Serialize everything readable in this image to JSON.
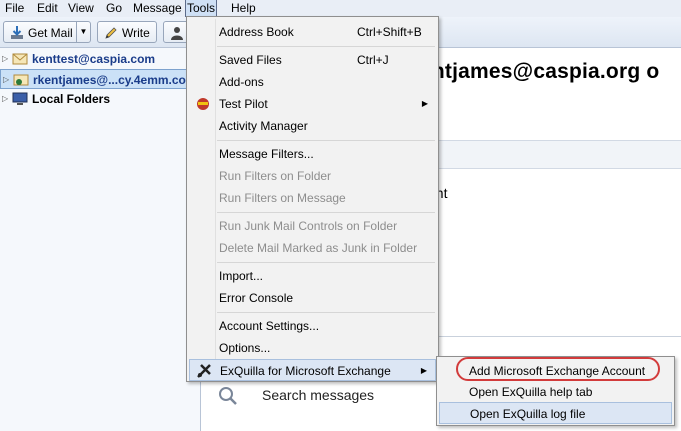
{
  "menubar": {
    "items": [
      "File",
      "Edit",
      "View",
      "Go",
      "Message",
      "Tools",
      "Help"
    ],
    "active": "Tools"
  },
  "toolbar": {
    "get_mail": "Get Mail",
    "write": "Write"
  },
  "folders": [
    {
      "label": "kenttest@caspia.com",
      "selected": false,
      "icon": "inbox-envelope-icon"
    },
    {
      "label": "rkentjames@...cy.4emm.co",
      "selected": true,
      "icon": "exchange-account-icon"
    },
    {
      "label": "Local Folders",
      "selected": false,
      "icon": "computer-icon"
    }
  ],
  "content": {
    "heading": "entjames@caspia.org o",
    "partial_text": "unt",
    "search_placeholder": "Search messages"
  },
  "tools_menu": {
    "items": [
      {
        "label": "Address Book",
        "shortcut": "Ctrl+Shift+B"
      },
      {
        "label": "Saved Files",
        "shortcut": "Ctrl+J"
      },
      {
        "label": "Add-ons"
      },
      {
        "label": "Test Pilot",
        "submenu": true
      },
      {
        "label": "Activity Manager"
      },
      {
        "label": "Message Filters..."
      },
      {
        "label": "Run Filters on Folder",
        "disabled": true
      },
      {
        "label": "Run Filters on Message",
        "disabled": true
      },
      {
        "label": "Run Junk Mail Controls on Folder",
        "disabled": true
      },
      {
        "label": "Delete Mail Marked as Junk in Folder",
        "disabled": true
      },
      {
        "label": "Import..."
      },
      {
        "label": "Error Console"
      },
      {
        "label": "Account Settings..."
      },
      {
        "label": "Options..."
      },
      {
        "label": "ExQuilla for Microsoft Exchange",
        "submenu": true,
        "highlighted": true
      }
    ]
  },
  "exquilla_submenu": {
    "items": [
      {
        "label": "Add Microsoft Exchange Account",
        "circled": true
      },
      {
        "label": "Open ExQuilla help tab"
      },
      {
        "label": "Open ExQuilla log file",
        "highlighted": true
      }
    ]
  },
  "colors": {
    "menu_bg": "#f2f2f2",
    "highlight": "#dce6f4",
    "annotation_red": "#d23b3b",
    "account_text": "#1a3c8a"
  }
}
